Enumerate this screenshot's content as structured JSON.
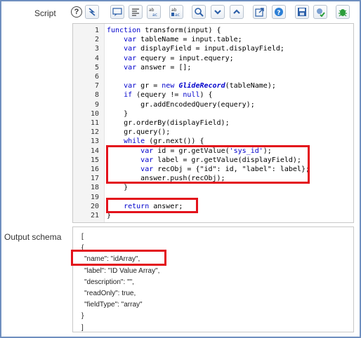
{
  "labels": {
    "script": "Script",
    "output_schema": "Output schema"
  },
  "toolbar": {
    "help_glyph": "?",
    "buttons": [
      "toggle-syntax-highlighting",
      "insert-comment",
      "format-code",
      "replace",
      "replace-all",
      "search",
      "collapse",
      "expand",
      "full-screen",
      "help",
      "save",
      "script-debugger",
      "debug"
    ]
  },
  "editor": {
    "lines": [
      "function transform(input) {",
      "    var tableName = input.table;",
      "    var displayField = input.displayField;",
      "    var equery = input.equery;",
      "    var answer = [];",
      "",
      "    var gr = new GlideRecord(tableName);",
      "    if (equery != null) {",
      "        gr.addEncodedQuery(equery);",
      "    }",
      "    gr.orderBy(displayField);",
      "    gr.query();",
      "    while (gr.next()) {",
      "        var id = gr.getValue('sys_id');",
      "        var label = gr.getValue(displayField);",
      "        var recObj = {\"id\": id, \"label\": label};",
      "        answer.push(recObj);",
      "    }",
      "",
      "    return answer;",
      "}"
    ],
    "line_numbers": [
      "1",
      "2",
      "3",
      "4",
      "5",
      "6",
      "7",
      "8",
      "9",
      "10",
      "11",
      "12",
      "13",
      "14",
      "15",
      "16",
      "17",
      "18",
      "19",
      "20",
      "21"
    ]
  },
  "schema": {
    "lines": [
      "[",
      "{",
      "\"name\": \"idArray\",",
      "\"label\": \"ID Value Array\",",
      "\"description\": \"\",",
      "\"readOnly\": true,",
      "\"fieldType\": \"array\"",
      "}",
      "]"
    ]
  },
  "colors": {
    "highlight": "#e3121b",
    "frame": "#6f8fbf",
    "keyword": "#0000cc"
  }
}
